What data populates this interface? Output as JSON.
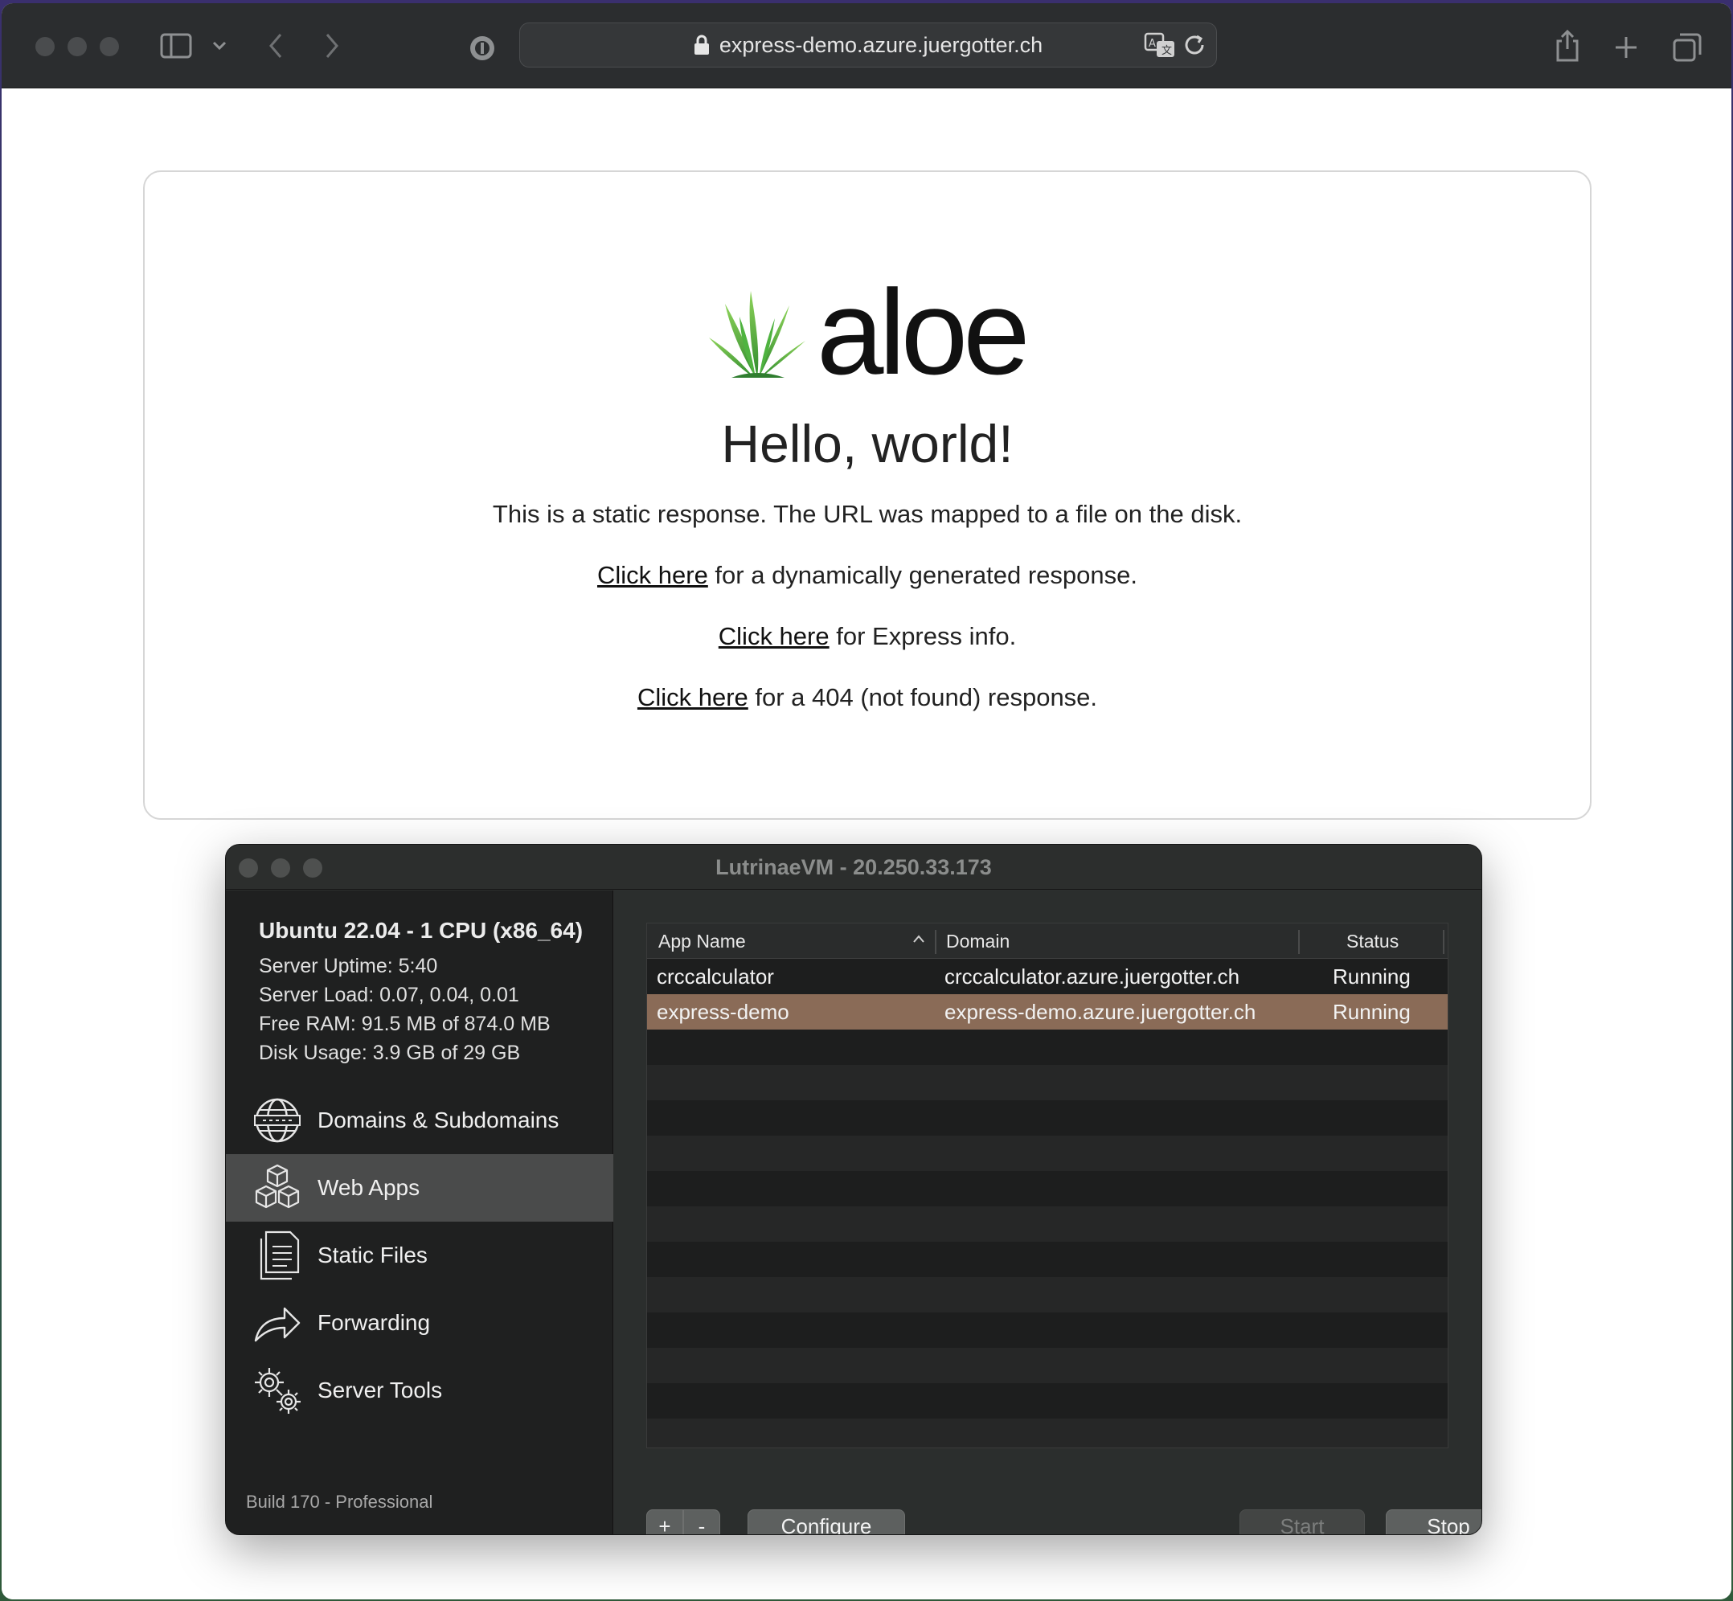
{
  "browser": {
    "url": "express-demo.azure.juergotter.ch"
  },
  "page": {
    "logo_text": "aloe",
    "heading": "Hello, world!",
    "static_text": "This is a static response. The URL was mapped to a file on the disk.",
    "links": [
      {
        "link": "Click here",
        "rest": " for a dynamically generated response."
      },
      {
        "link": "Click here",
        "rest": " for Express info."
      },
      {
        "link": "Click here",
        "rest": " for a 404 (not found) response."
      }
    ]
  },
  "app": {
    "title": "LutrinaeVM - 20.250.33.173",
    "system": {
      "title": "Ubuntu 22.04 - 1 CPU (x86_64)",
      "uptime": "Server Uptime:  5:40",
      "load": "Server Load: 0.07, 0.04, 0.01",
      "ram": "Free RAM: 91.5 MB of 874.0 MB",
      "disk": "Disk Usage: 3.9 GB of 29 GB"
    },
    "nav": [
      {
        "label": "Domains & Subdomains",
        "icon": "globe-icon"
      },
      {
        "label": "Web Apps",
        "icon": "cubes-icon",
        "active": true
      },
      {
        "label": "Static Files",
        "icon": "document-icon"
      },
      {
        "label": "Forwarding",
        "icon": "forward-arrow-icon"
      },
      {
        "label": "Server Tools",
        "icon": "gears-icon"
      }
    ],
    "build": "Build 170 - Professional",
    "table": {
      "headers": {
        "app_name": "App Name",
        "domain": "Domain",
        "status": "Status"
      },
      "rows": [
        {
          "app_name": "crccalculator",
          "domain": "crccalculator.azure.juergotter.ch",
          "status": "Running"
        },
        {
          "app_name": "express-demo",
          "domain": "express-demo.azure.juergotter.ch",
          "status": "Running",
          "selected": true
        }
      ]
    },
    "buttons": {
      "add": "+",
      "remove": "-",
      "configure": "Configure",
      "start": "Start",
      "stop": "Stop"
    },
    "colors": {
      "selection": "#8a6b57",
      "aloe_green": "#3fa83a"
    }
  }
}
